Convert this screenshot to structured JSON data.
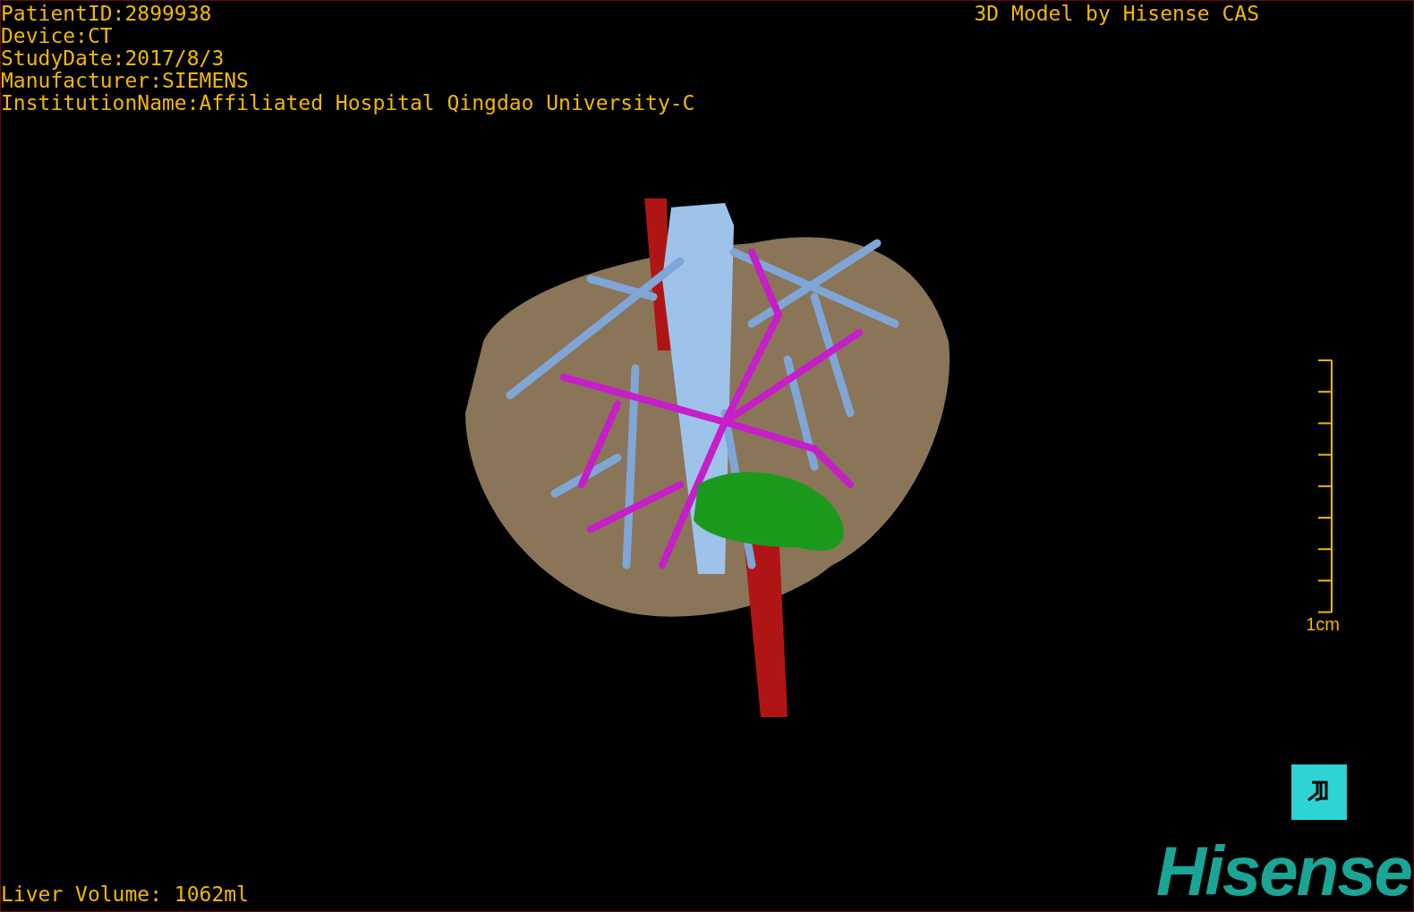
{
  "patient_info": [
    "PatientID:2899938",
    "Device:CT",
    "StudyDate:2017/8/3",
    "Manufacturer:SIEMENS",
    "InstitutionName:Affiliated Hospital Qingdao University-C"
  ],
  "title": "3D Model by Hisense CAS",
  "scale_bar": {
    "label": "1cm"
  },
  "measurement": "Liver Volume: 1062ml",
  "logo_text": "Hisense"
}
